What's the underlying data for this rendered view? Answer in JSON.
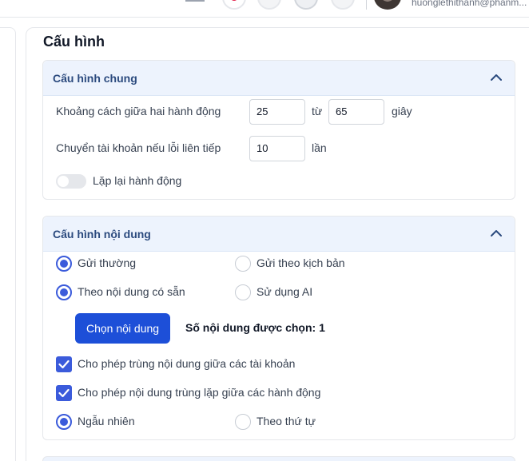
{
  "header": {
    "user_email": "huonglethithanh@phanm..."
  },
  "page": {
    "title": "Cấu hình"
  },
  "general": {
    "title": "Cấu hình chung",
    "delay_label": "Khoảng cách giữa hai hành động",
    "delay_min": "25",
    "delay_to": "từ",
    "delay_max": "65",
    "delay_unit": "giây",
    "switch_label": "Chuyển tài khoản nếu lỗi liên tiếp",
    "switch_value": "10",
    "switch_unit": "lần",
    "repeat_label": "Lặp lại hành động",
    "repeat_on": false
  },
  "content": {
    "title": "Cấu hình nội dung",
    "send_normal": "Gửi thường",
    "send_script": "Gửi theo kịch bản",
    "existing": "Theo nội dung có sẵn",
    "use_ai": "Sử dụng AI",
    "choose_btn": "Chọn nội dung",
    "selected_count": "Số nội dung được chọn: 1",
    "allow_dup_accounts": "Cho phép trùng nội dung giữa các tài khoản",
    "allow_dup_actions": "Cho phép nội dung trùng lặp giữa các hành động",
    "random": "Ngẫu nhiên",
    "sequential": "Theo thứ tự"
  },
  "colors": {
    "accent": "#3b5bdb",
    "button": "#1d4fd8",
    "section_header_bg": "#edf3fd"
  }
}
